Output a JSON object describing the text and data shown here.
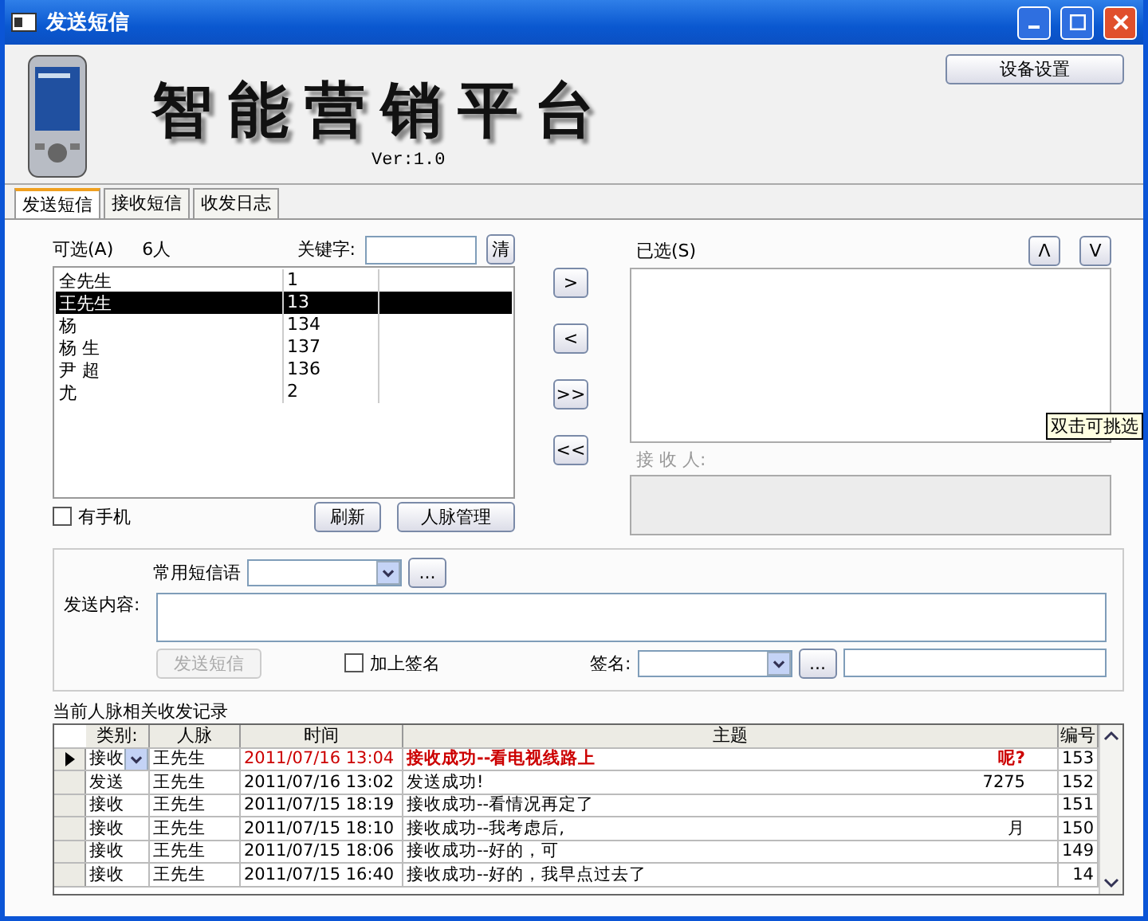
{
  "window": {
    "title": "发送短信"
  },
  "header": {
    "logo": "智能营销平台",
    "version": "Ver:1.0",
    "device_button": "设备设置"
  },
  "tabs": [
    {
      "label": "发送短信",
      "selected": true
    },
    {
      "label": "接收短信",
      "selected": false
    },
    {
      "label": "收发日志",
      "selected": false
    }
  ],
  "contacts": {
    "label": "可选(A)",
    "count": "6人",
    "keyword_label": "关键字:",
    "clear_button": "清",
    "rows": [
      {
        "name": "全先生",
        "phone": "1",
        "selected": false
      },
      {
        "name": "王先生",
        "phone": "13",
        "selected": true
      },
      {
        "name": "杨",
        "phone": "134",
        "selected": false
      },
      {
        "name": "杨 生",
        "phone": "137",
        "selected": false
      },
      {
        "name": "尹 超",
        "phone": "136",
        "selected": false
      },
      {
        "name": "尤",
        "phone": "2",
        "selected": false
      }
    ],
    "has_phone": {
      "label": "有手机",
      "checked": false
    },
    "buttons": [
      "刷新",
      "人脉管理"
    ]
  },
  "move_buttons": [
    ">",
    "<",
    ">>",
    "<<"
  ],
  "chosen": {
    "label": "已选(S)",
    "order_buttons": [
      "Λ",
      "V"
    ],
    "recipients_label": "接 收 人:",
    "tooltip": "双击可挑选"
  },
  "compose": {
    "phrase_label": "常用短信语",
    "browse_button": "...",
    "content_label": "发送内容:",
    "send_button": {
      "label": "发送短信",
      "disabled": true
    },
    "signature_check": {
      "label": "加上签名",
      "checked": false
    },
    "signature_label": "签名:",
    "signature_browse": "..."
  },
  "log": {
    "title": "当前人脉相关收发记录",
    "columns": [
      "类别:",
      "人脉",
      "时间",
      "主题",
      "编号"
    ],
    "rows": [
      {
        "kind": "接收",
        "person": "王先生",
        "time": "2011/07/16 13:04",
        "subject": "接收成功--看电视线路上",
        "subject_end": "呢?",
        "number": "153",
        "selected": true
      },
      {
        "kind": "发送",
        "person": "王先生",
        "time": "2011/07/16 13:02",
        "subject": "发送成功!",
        "subject_end": "7275",
        "number": "152",
        "selected": false
      },
      {
        "kind": "接收",
        "person": "王先生",
        "time": "2011/07/15 18:19",
        "subject": "接收成功--看情况再定了",
        "subject_end": "",
        "number": "151",
        "selected": false
      },
      {
        "kind": "接收",
        "person": "王先生",
        "time": "2011/07/15 18:10",
        "subject": "接收成功--我考虑后,",
        "subject_end": "月",
        "number": "150",
        "selected": false
      },
      {
        "kind": "接收",
        "person": "王先生",
        "time": "2011/07/15 18:06",
        "subject": "接收成功--好的，可",
        "subject_end": "",
        "number": "149",
        "selected": false
      },
      {
        "kind": "接收",
        "person": "王先生",
        "time": "2011/07/15 16:40",
        "subject": "接收成功--好的，我早点过去了",
        "subject_end": "",
        "number": "14",
        "selected": false
      }
    ]
  }
}
